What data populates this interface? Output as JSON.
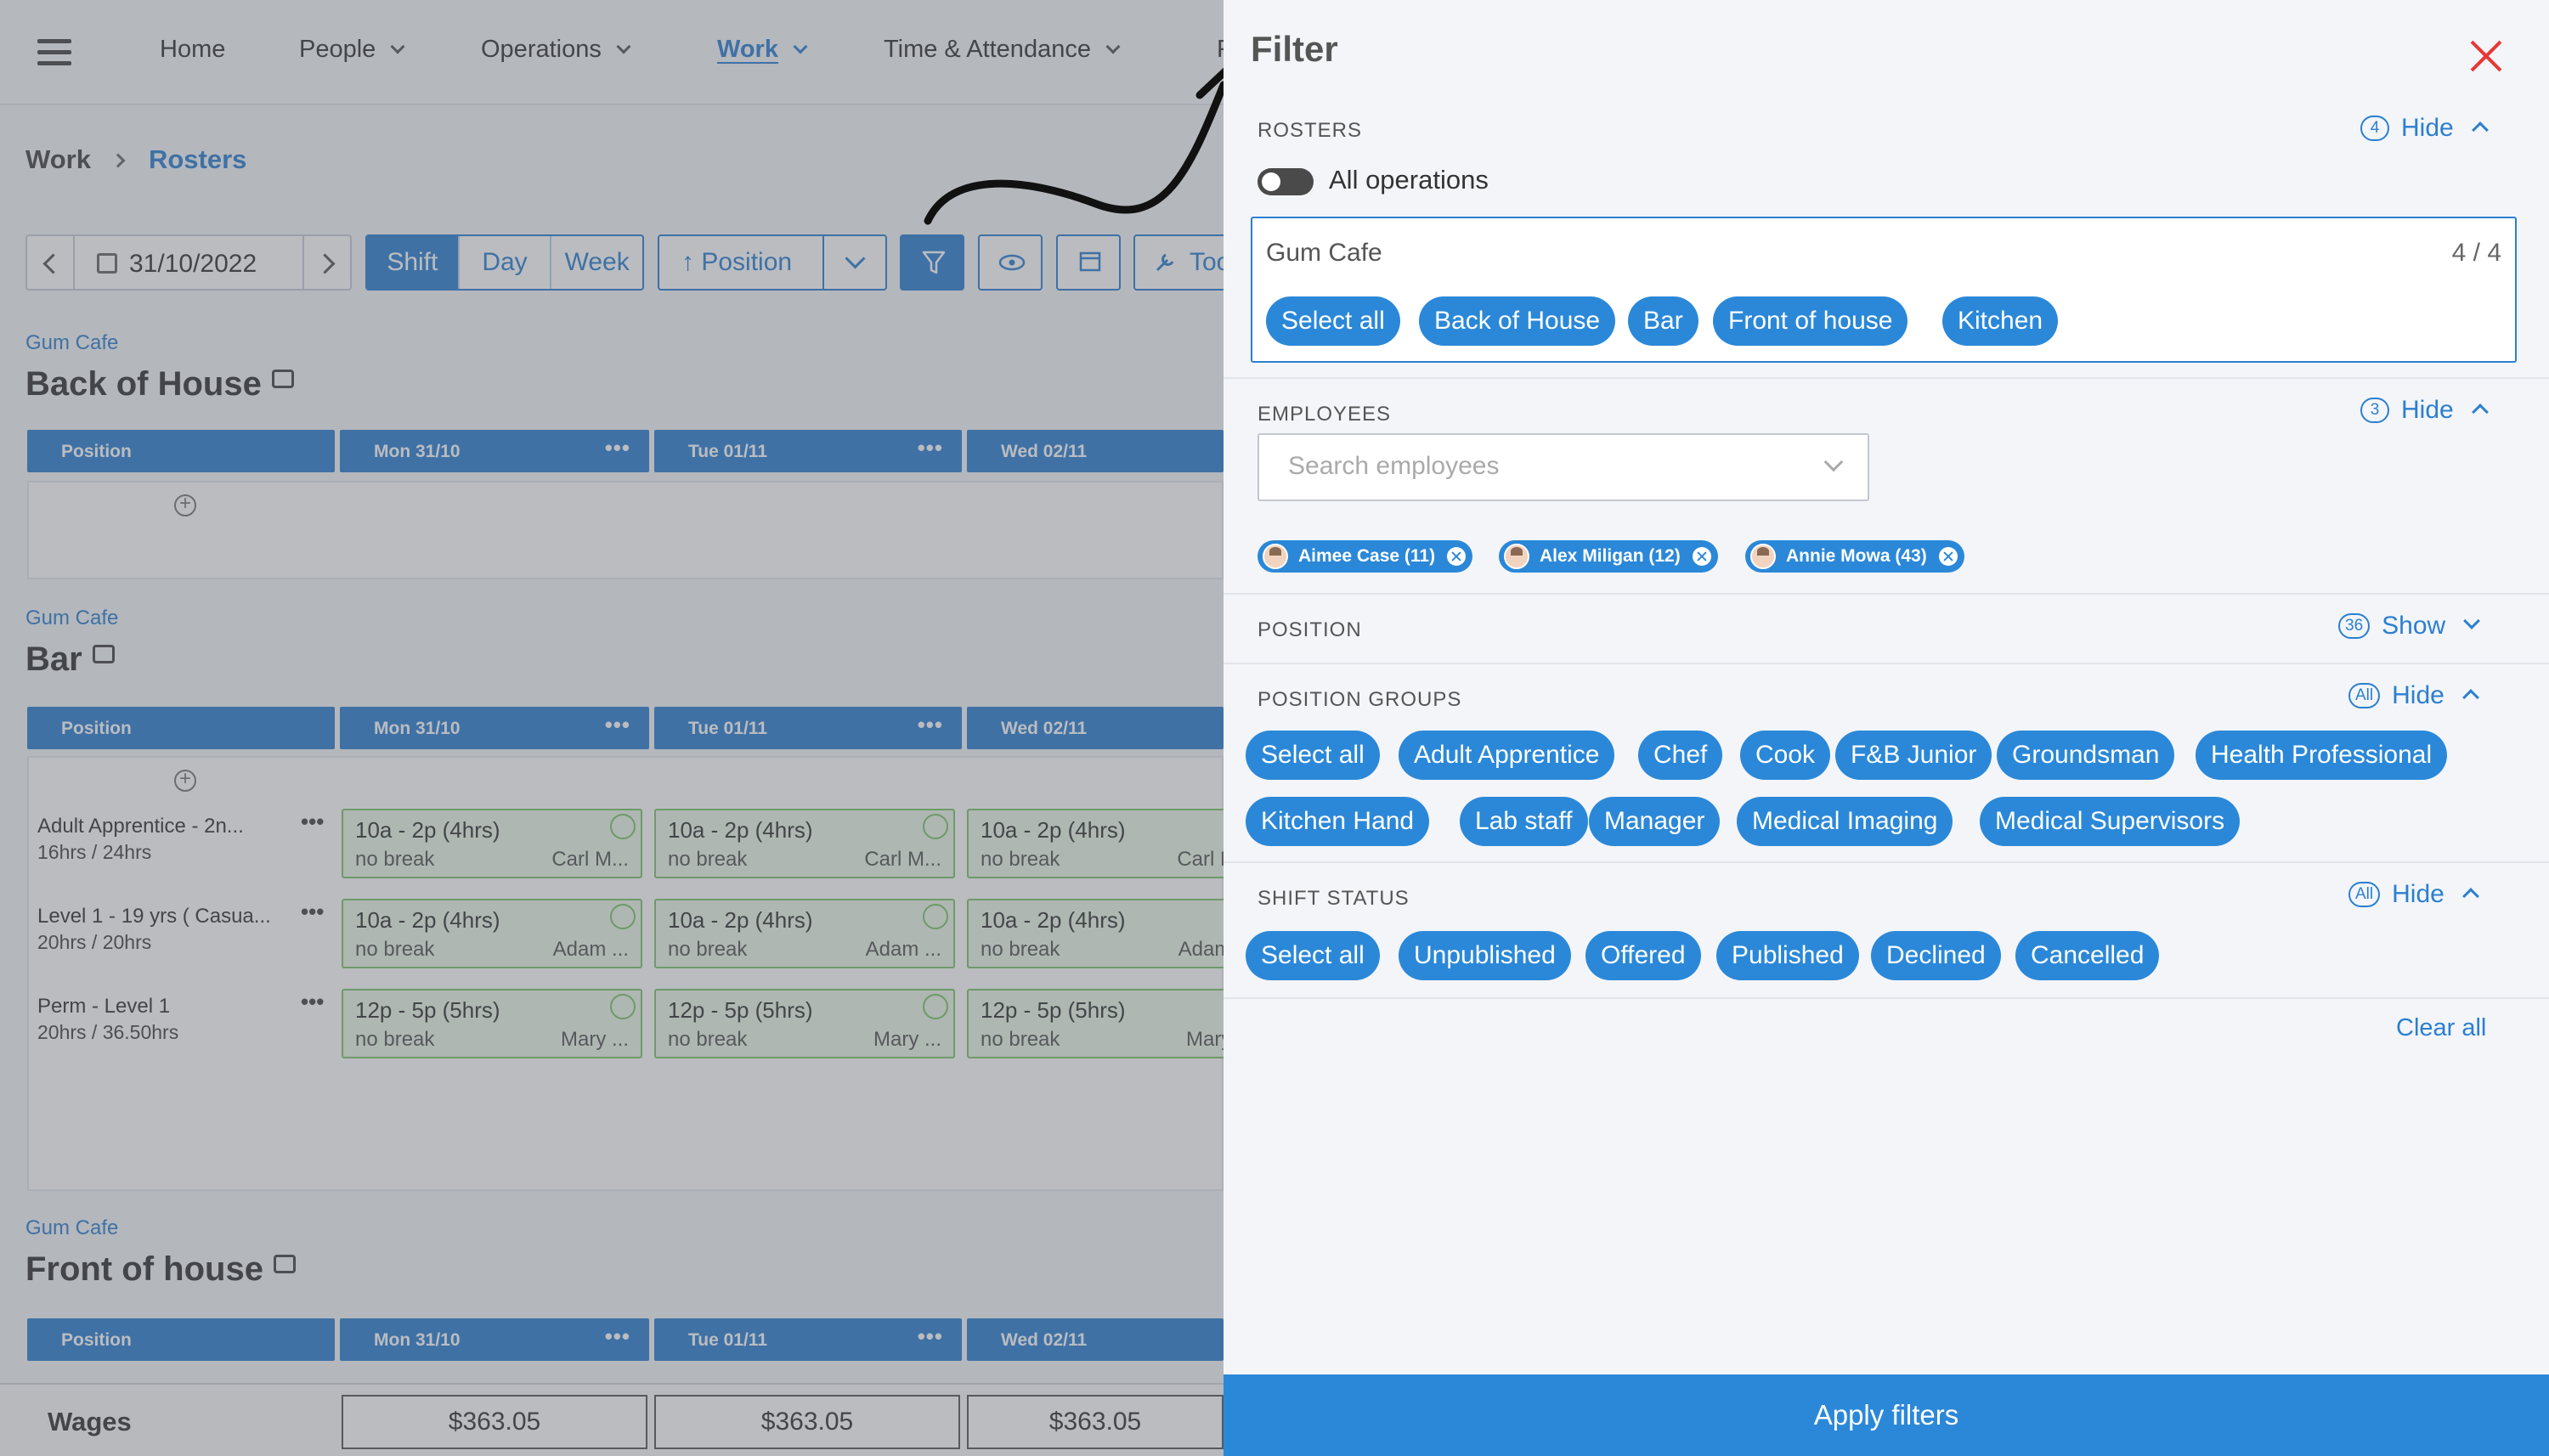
{
  "nav": {
    "items": [
      {
        "label": "Home"
      },
      {
        "label": "People"
      },
      {
        "label": "Operations"
      },
      {
        "label": "Work"
      },
      {
        "label": "Time & Attendance"
      }
    ],
    "cut_item": "F"
  },
  "breadcrumb": {
    "parent": "Work",
    "current": "Rosters"
  },
  "toolbar": {
    "date": "31/10/2022",
    "views": [
      "Shift",
      "Day",
      "Week"
    ],
    "active_view": "Shift",
    "sort_label": "↑ Position",
    "tools_label": "Too"
  },
  "sections": [
    {
      "location": "Gum Cafe",
      "title": "Back of House"
    },
    {
      "location": "Gum Cafe",
      "title": "Bar"
    },
    {
      "location": "Gum Cafe",
      "title": "Front of house"
    }
  ],
  "grid": {
    "position_header": "Position",
    "days": [
      "Mon 31/10",
      "Tue 01/11",
      "Wed 02/11"
    ]
  },
  "bar_rows": [
    {
      "label": "Adult Apprentice - 2n...",
      "hours": "16hrs / 24hrs",
      "shifts": [
        {
          "time": "10a  -  2p (4hrs)",
          "break": "no break",
          "who": "Carl M..."
        },
        {
          "time": "10a  -  2p (4hrs)",
          "break": "no break",
          "who": "Carl M..."
        },
        {
          "time": "10a  -  2p (4hrs)",
          "break": "no break",
          "who": "Carl M..."
        }
      ]
    },
    {
      "label": "Level 1 - 19 yrs ( Casua...",
      "hours": "20hrs / 20hrs",
      "shifts": [
        {
          "time": "10a  -  2p (4hrs)",
          "break": "no break",
          "who": "Adam ..."
        },
        {
          "time": "10a  -  2p (4hrs)",
          "break": "no break",
          "who": "Adam ..."
        },
        {
          "time": "10a  -  2p (4hrs)",
          "break": "no break",
          "who": "Adam ..."
        }
      ]
    },
    {
      "label": "Perm - Level 1",
      "hours": "20hrs / 36.50hrs",
      "shifts": [
        {
          "time": "12p  -  5p (5hrs)",
          "break": "no break",
          "who": "Mary ..."
        },
        {
          "time": "12p  -  5p (5hrs)",
          "break": "no break",
          "who": "Mary ..."
        },
        {
          "time": "12p  -  5p (5hrs)",
          "break": "no break",
          "who": "Mary ..."
        }
      ]
    }
  ],
  "wages": {
    "label": "Wages",
    "values": [
      "$363.05",
      "$363.05",
      "$363.05"
    ]
  },
  "filter": {
    "title": "Filter",
    "rosters": {
      "label": "ROSTERS",
      "count": "4",
      "toggle_label": "Hide",
      "all_operations_label": "All operations",
      "location": "Gum Cafe",
      "selected": "4 / 4",
      "chips": [
        "Select all",
        "Back of House",
        "Bar",
        "Front of house",
        "Kitchen"
      ]
    },
    "employees": {
      "label": "EMPLOYEES",
      "count": "3",
      "toggle_label": "Hide",
      "search_placeholder": "Search employees",
      "chips": [
        "Aimee Case (11)",
        "Alex Miligan (12)",
        "Annie Mowa (43)"
      ]
    },
    "position": {
      "label": "POSITION",
      "count": "36",
      "toggle_label": "Show"
    },
    "position_groups": {
      "label": "POSITION GROUPS",
      "count": "All",
      "toggle_label": "Hide",
      "chips": [
        "Select all",
        "Adult Apprentice",
        "Chef",
        "Cook",
        "F&B Junior",
        "Groundsman",
        "Health Professional",
        "Kitchen Hand",
        "Lab staff",
        "Manager",
        "Medical Imaging",
        "Medical Supervisors"
      ]
    },
    "shift_status": {
      "label": "SHIFT STATUS",
      "count": "All",
      "toggle_label": "Hide",
      "chips": [
        "Select all",
        "Unpublished",
        "Offered",
        "Published",
        "Declined",
        "Cancelled"
      ]
    },
    "clear_all": "Clear all",
    "apply": "Apply filters"
  },
  "colors": {
    "accent": "#2b88d8",
    "close": "#e53935",
    "shift_border": "#7cc46a"
  }
}
